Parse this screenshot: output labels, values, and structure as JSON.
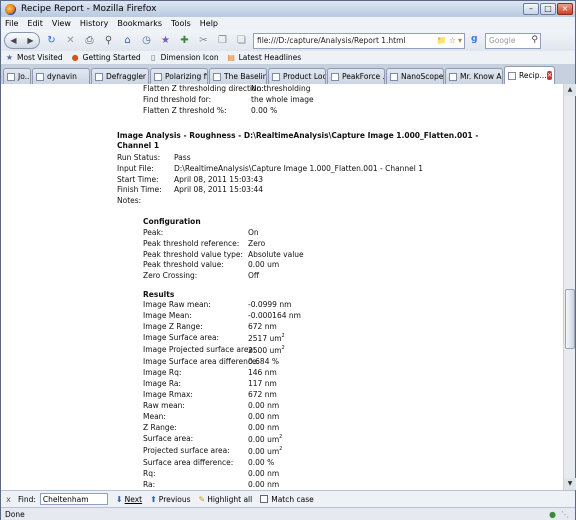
{
  "window": {
    "title": "Recipe Report - Mozilla Firefox"
  },
  "menu": [
    "File",
    "Edit",
    "View",
    "History",
    "Bookmarks",
    "Tools",
    "Help"
  ],
  "nav": {
    "url": "file:///D:/capture/Analysis/Report 1.html",
    "search_placeholder": "Google",
    "search_engine_icon": "g"
  },
  "bookmarks": [
    {
      "label": "Most Visited",
      "icon": "star-icon"
    },
    {
      "label": "Getting Started",
      "icon": "firefox-icon"
    },
    {
      "label": "Dimension Icon",
      "icon": "page-icon"
    },
    {
      "label": "Latest Headlines",
      "icon": "rss-icon"
    }
  ],
  "tabs": [
    {
      "label": "Jo..."
    },
    {
      "label": "dynavin"
    },
    {
      "label": "Defraggler -..."
    },
    {
      "label": "Polarizing fil..."
    },
    {
      "label": "The Baselin..."
    },
    {
      "label": "Product Loc..."
    },
    {
      "label": "PeakForce ..."
    },
    {
      "label": "NanoScope ..."
    },
    {
      "label": "Mr. Know All..."
    },
    {
      "label": "Recip...",
      "active": true
    }
  ],
  "report": {
    "flatten_rows": [
      {
        "label": "Flatten Z thresholding direction:",
        "value": "No thresholding"
      },
      {
        "label": "Find threshold for:",
        "value": "the whole image"
      },
      {
        "label": "Flatten Z threshold %:",
        "value": "0.00 %"
      }
    ],
    "roughness_title_1": "Image Analysis - Roughness - D:\\RealtimeAnalysis\\Capture Image 1.000_Flatten.001 -",
    "roughness_title_2": "Channel 1",
    "info_rows": [
      {
        "label": "Run Status:",
        "value": "Pass"
      },
      {
        "label": "Input File:",
        "value": "D:\\RealtimeAnalysis\\Capture Image 1.000_Flatten.001 - Channel 1"
      },
      {
        "label": "Start Time:",
        "value": "April 08, 2011 15:03:43"
      },
      {
        "label": "Finish Time:",
        "value": "April 08, 2011 15:03:44"
      },
      {
        "label": "Notes:",
        "value": ""
      }
    ],
    "configuration_heading": "Configuration",
    "config_rows": [
      {
        "label": "Peak:",
        "value": "On"
      },
      {
        "label": "Peak threshold reference:",
        "value": "Zero"
      },
      {
        "label": "Peak threshold value type:",
        "value": "Absolute value"
      },
      {
        "label": "Peak threshold value:",
        "value": "0.00 um"
      },
      {
        "label": "Zero Crossing:",
        "value": "Off"
      }
    ],
    "results_heading": "Results",
    "results_rows": [
      {
        "label": "Image Raw mean:",
        "value": "-0.0999 nm"
      },
      {
        "label": "Image Mean:",
        "value": "-0.000164 nm"
      },
      {
        "label": "Image Z Range:",
        "value": "672 nm"
      },
      {
        "label": "Image Surface area:",
        "value": "2517 um",
        "sup": "2"
      },
      {
        "label": "Image Projected surface area:",
        "value": "2500 um",
        "sup": "2"
      },
      {
        "label": "Image Surface area difference:",
        "value": "0.684 %"
      },
      {
        "label": "Image Rq:",
        "value": "146 nm"
      },
      {
        "label": "Image Ra:",
        "value": "117 nm"
      },
      {
        "label": "Image Rmax:",
        "value": "672 nm"
      },
      {
        "label": "Raw mean:",
        "value": "0.00 nm"
      },
      {
        "label": "Mean:",
        "value": "0.00 nm"
      },
      {
        "label": "Z Range:",
        "value": "0.00 nm"
      },
      {
        "label": "Surface area:",
        "value": "0.00 um",
        "sup": "2"
      },
      {
        "label": "Projected surface area:",
        "value": "0.00 um",
        "sup": "2"
      },
      {
        "label": "Surface area difference:",
        "value": "0.00 %"
      },
      {
        "label": "Rq:",
        "value": "0.00 nm"
      },
      {
        "label": "Ra:",
        "value": "0.00 nm"
      }
    ]
  },
  "findbar": {
    "close_glyph": "x",
    "label": "Find:",
    "query": "Cheltenham",
    "next": "Next",
    "previous": "Previous",
    "highlight": "Highlight all",
    "match_case": "Match case"
  },
  "status": {
    "text": "Done"
  }
}
